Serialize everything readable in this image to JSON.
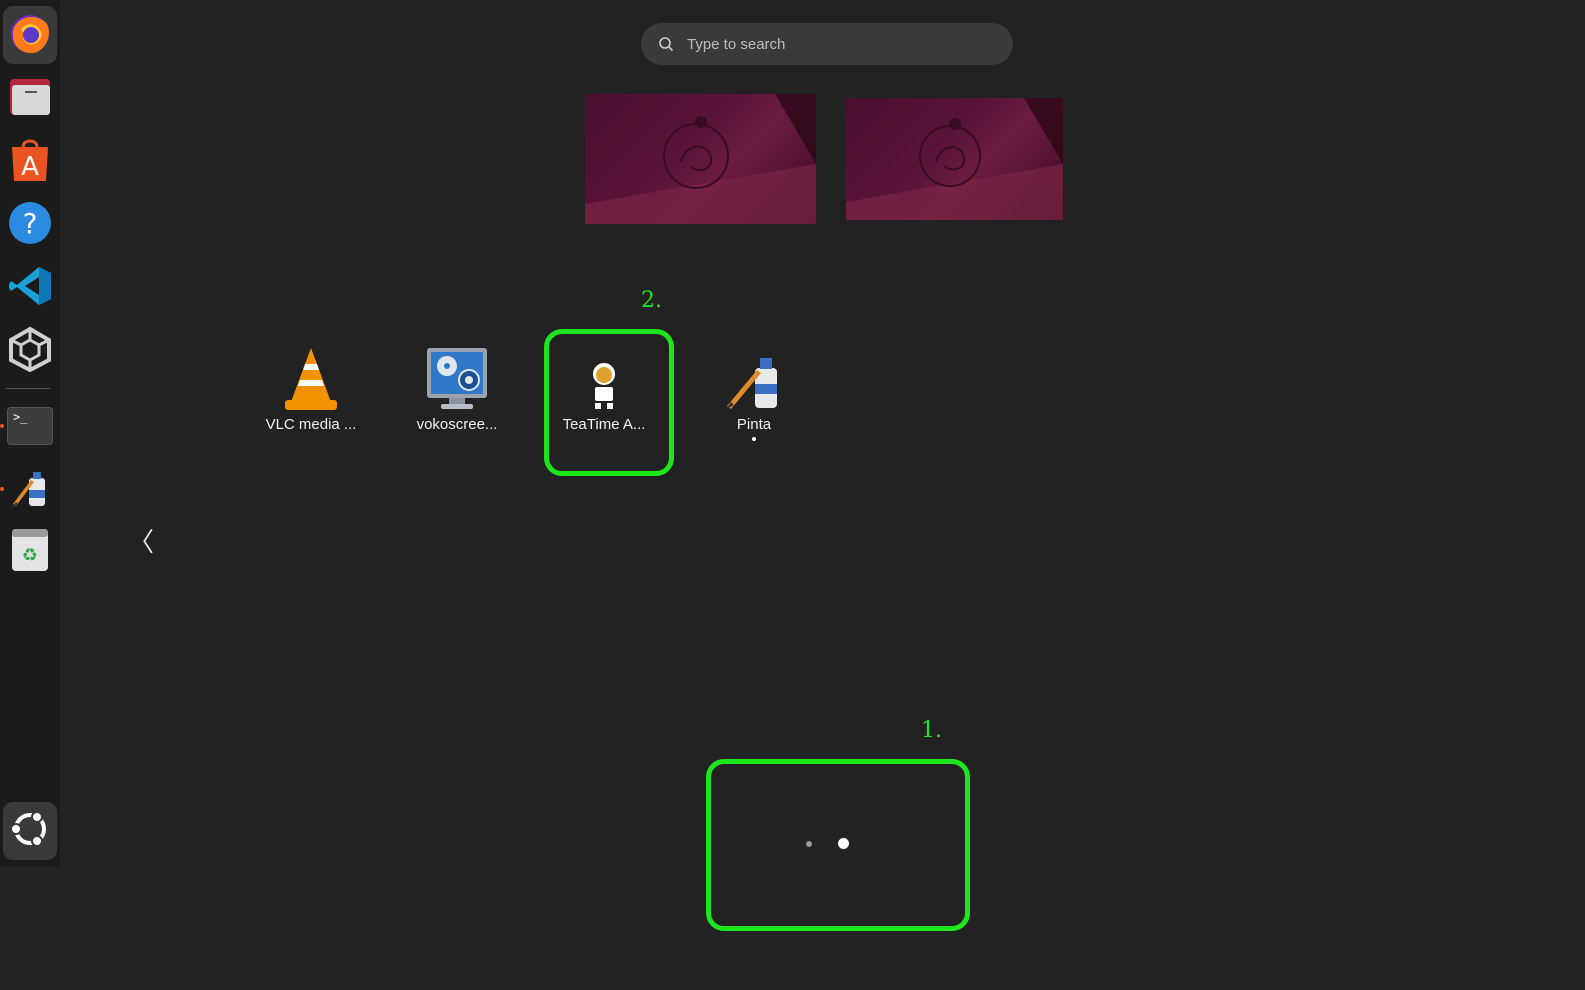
{
  "search": {
    "placeholder": "Type to search"
  },
  "dock": {
    "items": [
      {
        "name": "firefox"
      },
      {
        "name": "files"
      },
      {
        "name": "app-center"
      },
      {
        "name": "help"
      },
      {
        "name": "vscode"
      },
      {
        "name": "unity"
      },
      {
        "name": "terminal"
      },
      {
        "name": "pinta"
      },
      {
        "name": "trash"
      },
      {
        "name": "show-apps"
      }
    ],
    "terminal_prompt": ">_"
  },
  "apps": [
    {
      "label": "VLC media ..."
    },
    {
      "label": "vokoscree..."
    },
    {
      "label": "TeaTime A..."
    },
    {
      "label": "Pinta"
    }
  ],
  "annotations": {
    "marker_1": "1.",
    "marker_2": "2."
  },
  "colors": {
    "highlight": "#1ee61e",
    "background": "#222222",
    "dock": "#1b1b1b"
  },
  "pagination": {
    "pages": 2,
    "current": 2
  },
  "nav": {
    "prev_glyph": "〈"
  }
}
